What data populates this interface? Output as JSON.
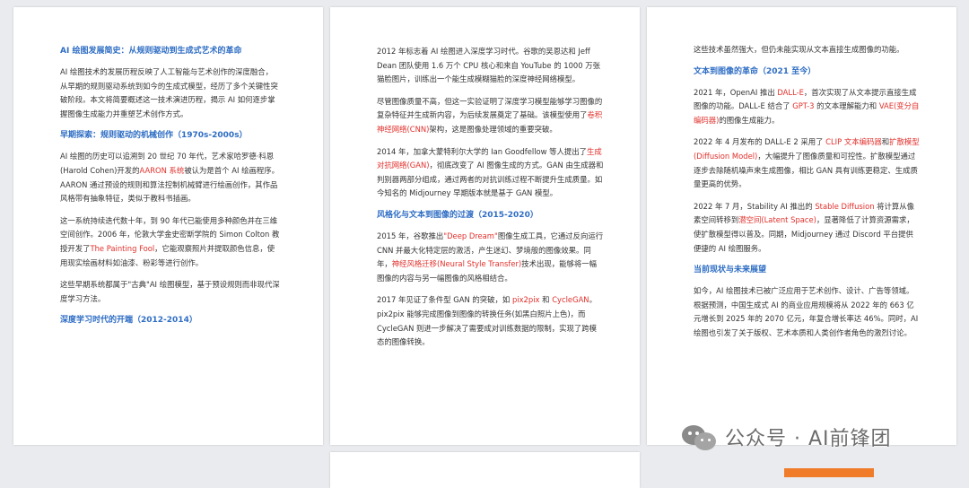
{
  "page1": {
    "title": "AI 绘图发展简史：从规则驱动到生成式艺术的革命",
    "intro": "AI 绘图技术的发展历程反映了人工智能与艺术创作的深度融合，从早期的规则驱动系统到如今的生成式模型，经历了多个关键性突破阶段。本文将简要概述这一技术演进历程，揭示 AI 如何逐步掌握图像生成能力并重塑艺术创作方式。",
    "h_early": "早期探索：规则驱动的机械创作（1970s-2000s）",
    "early_p1_a": "AI 绘图的历史可以追溯到 20 世纪 70 年代，艺术家哈罗德·科恩(Harold Cohen)开发的",
    "early_p1_red": "AARON 系统",
    "early_p1_b": "被认为是首个 AI 绘画程序。AARON 通过预设的规则和算法控制机械臂进行绘画创作，其作品风格带有抽象特征，类似于教科书插画。",
    "early_p2_a": "这一系统持续迭代数十年，到 90 年代已能使用多种颜色并在三维空间创作。2006 年，伦敦大学金史密斯学院的 Simon Colton 教授开发了",
    "early_p2_red": "The Painting Fool",
    "early_p2_b": "，它能观察照片并提取颜色信息，使用现实绘画材料如油漆、粉彩等进行创作。",
    "early_p3": "这些早期系统都属于\"古典\"AI 绘图模型，基于预设规则而非现代深度学习方法。",
    "h_dl": "深度学习时代的开端（2012-2014）"
  },
  "page2": {
    "p1": "2012 年标志着 AI 绘图进入深度学习时代。谷歌的吴恩达和 Jeff Dean 团队使用 1.6 万个 CPU 核心和来自 YouTube 的 1000 万张猫脸图片，训练出一个能生成模糊猫脸的深度神经网络模型。",
    "p2_a": "尽管图像质量不高，但这一实验证明了深度学习模型能够学习图像的复杂特征并生成新内容，为后续发展奠定了基础。该模型使用了",
    "p2_red": "卷积神经网络(CNN)",
    "p2_b": "架构，这是图像处理领域的重要突破。",
    "p3_a": "2014 年，加拿大蒙特利尔大学的 Ian Goodfellow 等人提出了",
    "p3_red": "生成对抗网络(GAN)",
    "p3_b": "，彻底改变了 AI 图像生成的方式。GAN 由生成器和判别器两部分组成，通过两者的对抗训练过程不断提升生成质量。如今知名的 Midjourney 早期版本就是基于 GAN 模型。",
    "h_style": "风格化与文本到图像的过渡（2015-2020）",
    "p4_a": "2015 年，谷歌推出",
    "p4_red": "\"Deep Dream\"",
    "p4_b": "图像生成工具，它通过反向运行 CNN 并最大化特定层的激活，产生迷幻、梦境般的图像效果。同年，",
    "p4_red2": "神经风格迁移(Neural Style Transfer)",
    "p4_c": "技术出现，能够将一幅图像的内容与另一幅图像的风格相结合。",
    "p5_a": "2017 年见证了条件型 GAN 的突破，如 ",
    "p5_red": "pix2pix",
    "p5_b": " 和 ",
    "p5_red2": "CycleGAN",
    "p5_c": "。pix2pix 能够完成图像到图像的转换任务(如黑白照片上色)，而 CycleGAN 则进一步解决了需要成对训练数据的限制，实现了跨模态的图像转换。"
  },
  "page3": {
    "p0": "这些技术虽然强大，但仍未能实现从文本直接生成图像的功能。",
    "h_t2i": "文本到图像的革命（2021 至今）",
    "p1_a": "2021 年，OpenAI 推出 ",
    "p1_red": "DALL-E",
    "p1_b": "，首次实现了从文本提示直接生成图像的功能。DALL-E 结合了 ",
    "p1_red2": "GPT-3",
    "p1_c": " 的文本理解能力和 ",
    "p1_red3": "VAE(变分自编码器)",
    "p1_d": "的图像生成能力。",
    "p2_a": "2022 年 4 月发布的 DALL-E 2 采用了 ",
    "p2_red": "CLIP 文本编码器",
    "p2_b": "和",
    "p2_red2": "扩散模型(Diffusion Model)",
    "p2_c": "，大幅提升了图像质量和可控性。扩散模型通过逐步去除随机噪声来生成图像，相比 GAN 具有训练更稳定、生成质量更高的优势。",
    "p3_a": "2022 年 7 月，Stability AI 推出的 ",
    "p3_red": "Stable Diffusion",
    "p3_b": " 将计算从像素空间转移到",
    "p3_red2": "潜空间(Latent Space)",
    "p3_c": "，显著降低了计算资源需求，使扩散模型得以普及。同期，Midjourney 通过 Discord 平台提供便捷的 AI 绘图服务。",
    "h_now": "当前现状与未来展望",
    "p4": "如今，AI 绘图技术已被广泛应用于艺术创作、设计、广告等领域。根据预测，中国生成式 AI 的商业应用规模将从 2022 年的 663 亿元增长到 2025 年的 2070 亿元，年复合增长率达 46%。同时，AI 绘图也引发了关于版权、艺术本质和人类创作者角色的激烈讨论。"
  },
  "watermark": {
    "text": "公众号 · AI前锋团"
  }
}
